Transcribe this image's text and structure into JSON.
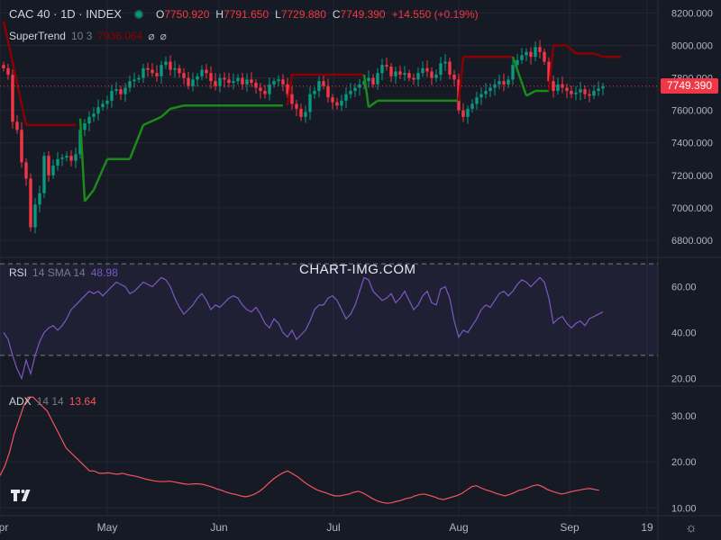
{
  "header": {
    "symbol": "CAC 40 · 1D · INDEX",
    "ohlc": [
      {
        "k": "O",
        "v": "7750.920"
      },
      {
        "k": "H",
        "v": "7791.650"
      },
      {
        "k": "L",
        "v": "7729.880"
      },
      {
        "k": "C",
        "v": "7749.390"
      }
    ],
    "change": "+14.550 (+0.19%)"
  },
  "supertrend": {
    "name": "SuperTrend",
    "params": "10 3",
    "value": "7936.064"
  },
  "rsi": {
    "name": "RSI",
    "params": "14 SMA 14",
    "value": "48.98"
  },
  "adx": {
    "name": "ADX",
    "params": "14 14",
    "value": "13.64"
  },
  "watermark": "CHART-IMG.COM",
  "last_price": "7749.390",
  "colors": {
    "up": "#089981",
    "down": "#f23645",
    "st_up": "#1b8a1b",
    "st_down": "#8b0000",
    "rsi": "#7e57c2",
    "adx": "#f7525f",
    "bg": "#161a25",
    "grid": "#232733"
  },
  "chart_data": [
    {
      "type": "candlestick",
      "title": "CAC 40 · 1D · INDEX",
      "ylim": [
        6700,
        8280
      ],
      "y_ticks": [
        "8200.000",
        "8000.000",
        "7800.000",
        "7600.000",
        "7400.000",
        "7200.000",
        "7000.000",
        "6800.000"
      ],
      "x_ticks": [
        "Apr",
        "May",
        "Jun",
        "Jul",
        "Aug",
        "Sep",
        "19"
      ],
      "last_value": 7749.39,
      "close": [
        7860,
        7820,
        7530,
        7480,
        7280,
        7180,
        6880,
        7020,
        7090,
        7320,
        7200,
        7260,
        7300,
        7310,
        7320,
        7290,
        7330,
        7480,
        7520,
        7560,
        7580,
        7620,
        7640,
        7660,
        7720,
        7730,
        7700,
        7740,
        7780,
        7790,
        7800,
        7860,
        7850,
        7830,
        7810,
        7880,
        7900,
        7850,
        7860,
        7830,
        7800,
        7750,
        7790,
        7810,
        7850,
        7830,
        7780,
        7750,
        7800,
        7790,
        7770,
        7780,
        7800,
        7760,
        7790,
        7770,
        7740,
        7720,
        7700,
        7760,
        7780,
        7790,
        7760,
        7700,
        7640,
        7610,
        7560,
        7590,
        7700,
        7720,
        7780,
        7750,
        7680,
        7650,
        7630,
        7660,
        7700,
        7720,
        7740,
        7760,
        7780,
        7800,
        7760,
        7830,
        7880,
        7870,
        7810,
        7840,
        7820,
        7830,
        7800,
        7790,
        7830,
        7860,
        7840,
        7800,
        7820,
        7890,
        7900,
        7820,
        7790,
        7600,
        7560,
        7610,
        7640,
        7680,
        7700,
        7720,
        7740,
        7760,
        7780,
        7760,
        7790,
        7880,
        7910,
        7940,
        7960,
        7930,
        7990,
        7960,
        7900,
        7780,
        7720,
        7760,
        7740,
        7720,
        7700,
        7710,
        7730,
        7700,
        7690,
        7720,
        7735,
        7749
      ],
      "open": [
        7880,
        7860,
        7820,
        7530,
        7480,
        7280,
        7180,
        6880,
        7020,
        7090,
        7320,
        7200,
        7260,
        7300,
        7310,
        7320,
        7290,
        7330,
        7480,
        7520,
        7560,
        7580,
        7620,
        7640,
        7660,
        7720,
        7730,
        7700,
        7740,
        7780,
        7790,
        7800,
        7860,
        7850,
        7830,
        7810,
        7880,
        7900,
        7850,
        7860,
        7830,
        7800,
        7750,
        7790,
        7810,
        7850,
        7830,
        7780,
        7750,
        7800,
        7790,
        7770,
        7780,
        7800,
        7760,
        7790,
        7770,
        7740,
        7720,
        7700,
        7760,
        7780,
        7790,
        7760,
        7700,
        7640,
        7610,
        7560,
        7590,
        7700,
        7720,
        7780,
        7750,
        7680,
        7650,
        7630,
        7660,
        7700,
        7720,
        7740,
        7760,
        7780,
        7800,
        7760,
        7830,
        7880,
        7870,
        7810,
        7840,
        7820,
        7830,
        7800,
        7790,
        7830,
        7860,
        7840,
        7800,
        7820,
        7890,
        7900,
        7820,
        7790,
        7600,
        7560,
        7610,
        7640,
        7680,
        7700,
        7720,
        7740,
        7760,
        7780,
        7760,
        7790,
        7880,
        7910,
        7940,
        7960,
        7930,
        7990,
        7960,
        7900,
        7780,
        7720,
        7760,
        7740,
        7720,
        7700,
        7710,
        7730,
        7700,
        7690,
        7720,
        7735
      ],
      "supertrend": [
        {
          "x": 0,
          "y": 8150,
          "dir": "down"
        },
        {
          "x": 5,
          "y": 7510,
          "dir": "down"
        },
        {
          "x": 16,
          "y": 7510,
          "dir": "down"
        },
        {
          "x": 17,
          "y": 7550,
          "dir": "up"
        },
        {
          "x": 18,
          "y": 7040,
          "dir": "up"
        },
        {
          "x": 20,
          "y": 7110,
          "dir": "up"
        },
        {
          "x": 23,
          "y": 7300,
          "dir": "up"
        },
        {
          "x": 28,
          "y": 7300,
          "dir": "up"
        },
        {
          "x": 31,
          "y": 7510,
          "dir": "up"
        },
        {
          "x": 35,
          "y": 7560,
          "dir": "up"
        },
        {
          "x": 37,
          "y": 7610,
          "dir": "up"
        },
        {
          "x": 40,
          "y": 7630,
          "dir": "up"
        },
        {
          "x": 62,
          "y": 7630,
          "dir": "up"
        },
        {
          "x": 63,
          "y": 7630,
          "dir": "down"
        },
        {
          "x": 64,
          "y": 7820,
          "dir": "down"
        },
        {
          "x": 80,
          "y": 7820,
          "dir": "down"
        },
        {
          "x": 80,
          "y": 7820,
          "dir": "up"
        },
        {
          "x": 81,
          "y": 7620,
          "dir": "up"
        },
        {
          "x": 83,
          "y": 7660,
          "dir": "up"
        },
        {
          "x": 101,
          "y": 7660,
          "dir": "up"
        },
        {
          "x": 101,
          "y": 7660,
          "dir": "down"
        },
        {
          "x": 102,
          "y": 7930,
          "dir": "down"
        },
        {
          "x": 113,
          "y": 7930,
          "dir": "down"
        },
        {
          "x": 113,
          "y": 7930,
          "dir": "up"
        },
        {
          "x": 116,
          "y": 7690,
          "dir": "up"
        },
        {
          "x": 118,
          "y": 7720,
          "dir": "up"
        },
        {
          "x": 121,
          "y": 7720,
          "dir": "up"
        },
        {
          "x": 121,
          "y": 7720,
          "dir": "down"
        },
        {
          "x": 122,
          "y": 8000,
          "dir": "down"
        },
        {
          "x": 125,
          "y": 8000,
          "dir": "down"
        },
        {
          "x": 127,
          "y": 7950,
          "dir": "down"
        },
        {
          "x": 131,
          "y": 7950,
          "dir": "down"
        },
        {
          "x": 133,
          "y": 7930,
          "dir": "down"
        },
        {
          "x": 137,
          "y": 7930,
          "dir": "down"
        }
      ]
    },
    {
      "type": "line",
      "title": "RSI 14 SMA 14",
      "ylim": [
        17,
        72
      ],
      "y_ticks": [
        "60.00",
        "40.00",
        "20.00"
      ],
      "bands": [
        30,
        70
      ],
      "values": [
        40,
        37,
        30,
        24,
        20,
        28,
        22,
        30,
        36,
        40,
        42,
        43,
        41,
        43,
        46,
        50,
        52,
        54,
        56,
        58,
        57,
        58,
        56,
        58,
        60,
        62,
        61,
        60,
        57,
        58,
        60,
        62,
        61,
        60,
        62,
        64,
        63,
        60,
        55,
        51,
        48,
        50,
        52,
        55,
        57,
        54,
        50,
        52,
        51,
        53,
        55,
        56,
        55,
        52,
        50,
        49,
        51,
        48,
        44,
        42,
        46,
        44,
        40,
        38,
        41,
        37,
        39,
        41,
        45,
        50,
        52,
        52,
        55,
        56,
        54,
        50,
        46,
        48,
        52,
        58,
        64,
        63,
        58,
        56,
        54,
        55,
        57,
        53,
        55,
        58,
        54,
        50,
        52,
        56,
        58,
        53,
        52,
        59,
        60,
        55,
        45,
        38,
        41,
        40,
        43,
        46,
        50,
        52,
        51,
        54,
        57,
        58,
        56,
        58,
        61,
        63,
        62,
        60,
        62,
        64,
        62,
        55,
        44,
        46,
        47,
        44,
        42,
        44,
        45,
        43,
        46,
        47,
        48,
        49
      ]
    },
    {
      "type": "line",
      "title": "ADX 14 14",
      "ylim": [
        8.5,
        36
      ],
      "y_ticks": [
        "30.00",
        "20.00",
        "10.00"
      ],
      "values": [
        17,
        19,
        22,
        26,
        29,
        32,
        34,
        34,
        33,
        32,
        31,
        29,
        27,
        25,
        23,
        22,
        21,
        20,
        19,
        18,
        18,
        17.5,
        17.5,
        17.6,
        17.4,
        17.3,
        17.5,
        17.2,
        17,
        16.8,
        16.5,
        16.2,
        16,
        15.8,
        15.7,
        15.7,
        15.8,
        15.6,
        15.4,
        15.2,
        15.1,
        15.2,
        15.2,
        15.1,
        14.8,
        14.5,
        14.1,
        13.8,
        13.4,
        13.1,
        12.9,
        12.6,
        12.4,
        12.6,
        13,
        13.6,
        14.4,
        15.4,
        16.3,
        17,
        17.6,
        18,
        17.4,
        16.8,
        16,
        15.2,
        14.6,
        14,
        13.6,
        13.3,
        12.9,
        12.6,
        12.6,
        12.8,
        13,
        13.4,
        13.6,
        13.2,
        12.6,
        12,
        11.5,
        11.2,
        11,
        11.1,
        11.4,
        11.6,
        12,
        12.2,
        12.6,
        12.9,
        13,
        12.7,
        12.4,
        12,
        11.8,
        12.1,
        12.4,
        12.7,
        13.2,
        13.9,
        14.6,
        14.8,
        14.3,
        13.9,
        13.6,
        13.2,
        12.9,
        12.6,
        12.9,
        13.3,
        13.8,
        14,
        14.4,
        14.8,
        15,
        14.6,
        14,
        13.6,
        13.3,
        13,
        13.2,
        13.5,
        13.7,
        13.9,
        14.1,
        14.2,
        14,
        13.8
      ]
    }
  ]
}
